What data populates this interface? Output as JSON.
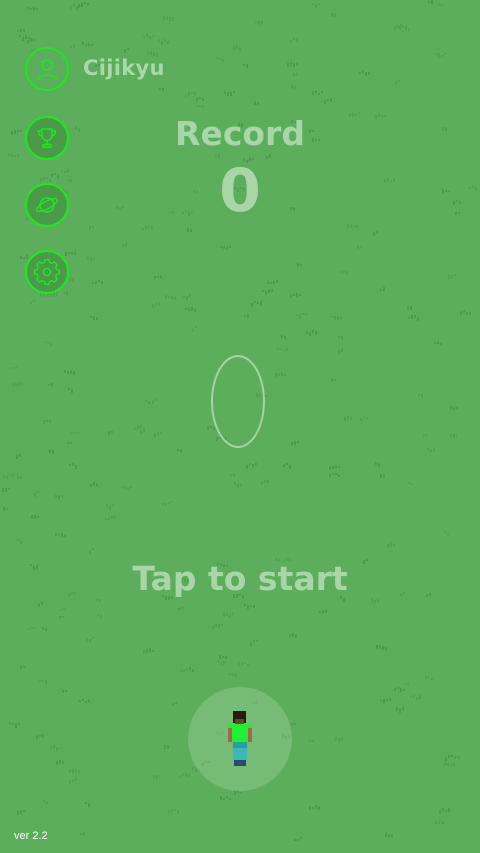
{
  "profile": {
    "username": "Cijikyu",
    "icon": "user-icon"
  },
  "menu": [
    {
      "name": "leaderboard",
      "icon": "trophy-icon"
    },
    {
      "name": "worlds",
      "icon": "planet-icon"
    },
    {
      "name": "settings",
      "icon": "gear-icon"
    }
  ],
  "record": {
    "label": "Record",
    "value": "0"
  },
  "prompt": "Tap to start",
  "version": "ver 2.2",
  "colors": {
    "background": "#5cad5c",
    "accent": "#1ee81e",
    "text": "#a8d6a8",
    "player_shirt": "#22ee33",
    "player_pants": "#3cb8b8"
  }
}
